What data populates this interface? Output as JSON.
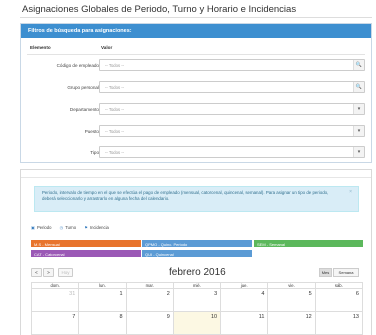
{
  "page": {
    "title": "Asignaciones Globales de Periodo, Turno y Horario e Incidencias"
  },
  "filters": {
    "panel_title": "Filtros de búsqueda para asignaciones:",
    "col_element": "Elemento",
    "col_value": "Valor",
    "rows": [
      {
        "label": "Código de empleado",
        "value": "-- Todos --",
        "button": "search-icon",
        "glyph": "🔍"
      },
      {
        "label": "Grupo personal",
        "value": "-- Todos --",
        "button": "search-icon",
        "glyph": "🔍"
      },
      {
        "label": "Departamento",
        "value": "-- Todos --",
        "button": "chevron-down-icon",
        "glyph": "▾"
      },
      {
        "label": "Puesto",
        "value": "-- Todos --",
        "button": "chevron-down-icon",
        "glyph": "▾"
      },
      {
        "label": "Tipo",
        "value": "-- Todos --",
        "button": "chevron-down-icon",
        "glyph": "▾"
      }
    ]
  },
  "calendar": {
    "info_text": "Periodo, intervalo de tiempo en el que se efectúa el pago de empleado (mensual, catorcenal, quincenal, semanal). Para asignar un tipo de periodo, deberá seleccionarlo y arrastrarlo en alguna fecha del calendario.",
    "info_close": "×",
    "legend": [
      "Periodo",
      "Turno",
      "Incidencia"
    ],
    "chips": [
      {
        "label": "M.S - Mensual",
        "color": "#e8742c"
      },
      {
        "label": "QPMO - Quinc. Periodo",
        "color": "#5b9bd5"
      },
      {
        "label": "SEM - Semanal",
        "color": "#5cb85c"
      },
      {
        "label": "CAT - Catorcenal",
        "color": "#9b59b6"
      },
      {
        "label": "QUI - Quincenal",
        "color": "#5b9bd5"
      }
    ],
    "prev_label": "<",
    "next_label": ">",
    "today_label": "Hoy",
    "month_title": "febrero 2016",
    "view_month": "Mes",
    "view_week": "Semana",
    "weekdays": [
      "dom.",
      "lun.",
      "mar.",
      "mié.",
      "jue.",
      "vie.",
      "sáb."
    ],
    "weeks": [
      [
        {
          "d": "31",
          "other": true
        },
        {
          "d": "1"
        },
        {
          "d": "2"
        },
        {
          "d": "3"
        },
        {
          "d": "4"
        },
        {
          "d": "5"
        },
        {
          "d": "6"
        }
      ],
      [
        {
          "d": "7"
        },
        {
          "d": "8"
        },
        {
          "d": "9"
        },
        {
          "d": "10",
          "today": true
        },
        {
          "d": "11"
        },
        {
          "d": "12"
        },
        {
          "d": "13"
        }
      ]
    ]
  }
}
